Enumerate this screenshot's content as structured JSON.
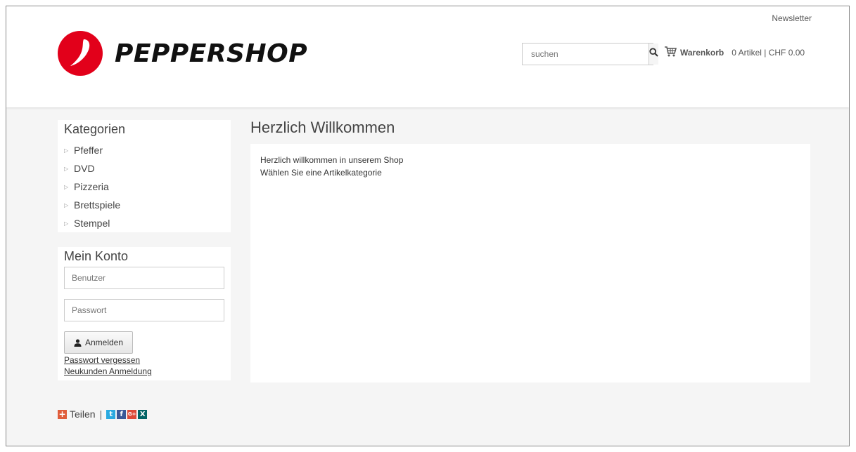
{
  "header": {
    "newsletter_link": "Newsletter",
    "logo_text": "PEPPERSHOP",
    "search_placeholder": "suchen",
    "cart_label": "Warenkorb",
    "cart_info": "0 Artikel | CHF 0.00"
  },
  "sidebar": {
    "categories_title": "Kategorien",
    "categories": [
      "Pfeffer",
      "DVD",
      "Pizzeria",
      "Brettspiele",
      "Stempel"
    ],
    "account_title": "Mein Konto",
    "username_placeholder": "Benutzer",
    "password_placeholder": "Passwort",
    "login_button": "Anmelden",
    "forgot_password_link": "Passwort vergessen",
    "register_link": "Neukunden Anmeldung"
  },
  "main": {
    "title": "Herzlich Willkommen",
    "line1": "Herzlich willkommen in unserem Shop",
    "line2": "Wählen Sie eine Artikelkategorie"
  },
  "footer": {
    "share_label": "Teilen",
    "separator": "|"
  },
  "colors": {
    "brand_red": "#e2001a",
    "twitter": "#2aa9e0",
    "facebook": "#3b5998",
    "google_plus": "#dd4b39",
    "xing": "#026466",
    "share_plus": "#e05d3b"
  },
  "icons": {
    "logo": "pepper-logo-icon",
    "search": "magnifier-icon",
    "cart": "shopping-cart-icon",
    "category_bullet": "triangle-right-icon",
    "login": "user-icon",
    "share": "plus-icon",
    "social": [
      "twitter-icon",
      "facebook-icon",
      "google-plus-icon",
      "xing-icon"
    ]
  }
}
